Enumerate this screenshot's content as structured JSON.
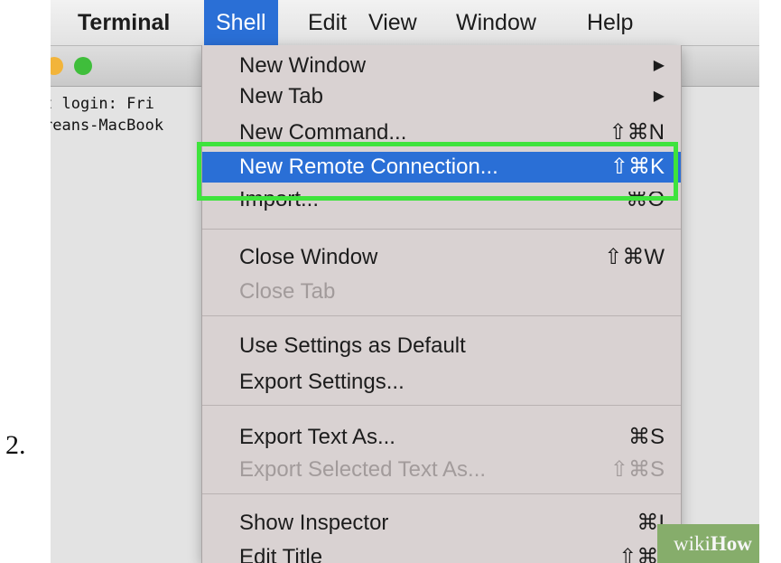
{
  "step_number": "2.",
  "menubar": {
    "items": [
      "Terminal",
      "Shell",
      "Edit",
      "View",
      "Window",
      "Help"
    ]
  },
  "terminal": {
    "lines": [
      "t login: Fri",
      "reans-MacBook"
    ]
  },
  "shell_menu": {
    "items": [
      {
        "label": "New Window",
        "shortcut": "▶",
        "state": "normal"
      },
      {
        "label": "New Tab",
        "shortcut": "▶",
        "state": "normal"
      },
      {
        "label": "New Command...",
        "shortcut": "⇧⌘N",
        "state": "normal"
      },
      {
        "label": "New Remote Connection...",
        "shortcut": "⇧⌘K",
        "state": "highlighted"
      },
      {
        "label": "Import...",
        "shortcut": "⌘O",
        "state": "normal"
      },
      {
        "label": "Close Window",
        "shortcut": "⇧⌘W",
        "state": "normal"
      },
      {
        "label": "Close Tab",
        "shortcut": "",
        "state": "disabled"
      },
      {
        "label": "Use Settings as Default",
        "shortcut": "",
        "state": "normal"
      },
      {
        "label": "Export Settings...",
        "shortcut": "",
        "state": "normal"
      },
      {
        "label": "Export Text As...",
        "shortcut": "⌘S",
        "state": "normal"
      },
      {
        "label": "Export Selected Text As...",
        "shortcut": "⇧⌘S",
        "state": "disabled"
      },
      {
        "label": "Show Inspector",
        "shortcut": "⌘I",
        "state": "normal"
      },
      {
        "label": "Edit Title",
        "shortcut": "⇧⌘I",
        "state": "normal"
      }
    ]
  },
  "watermark": {
    "part1": "wiki",
    "part2": "How"
  },
  "colors": {
    "menu_highlight": "#2a6fd6",
    "annotation_box": "#3ee33c",
    "watermark_bg": "#86ad6b"
  }
}
